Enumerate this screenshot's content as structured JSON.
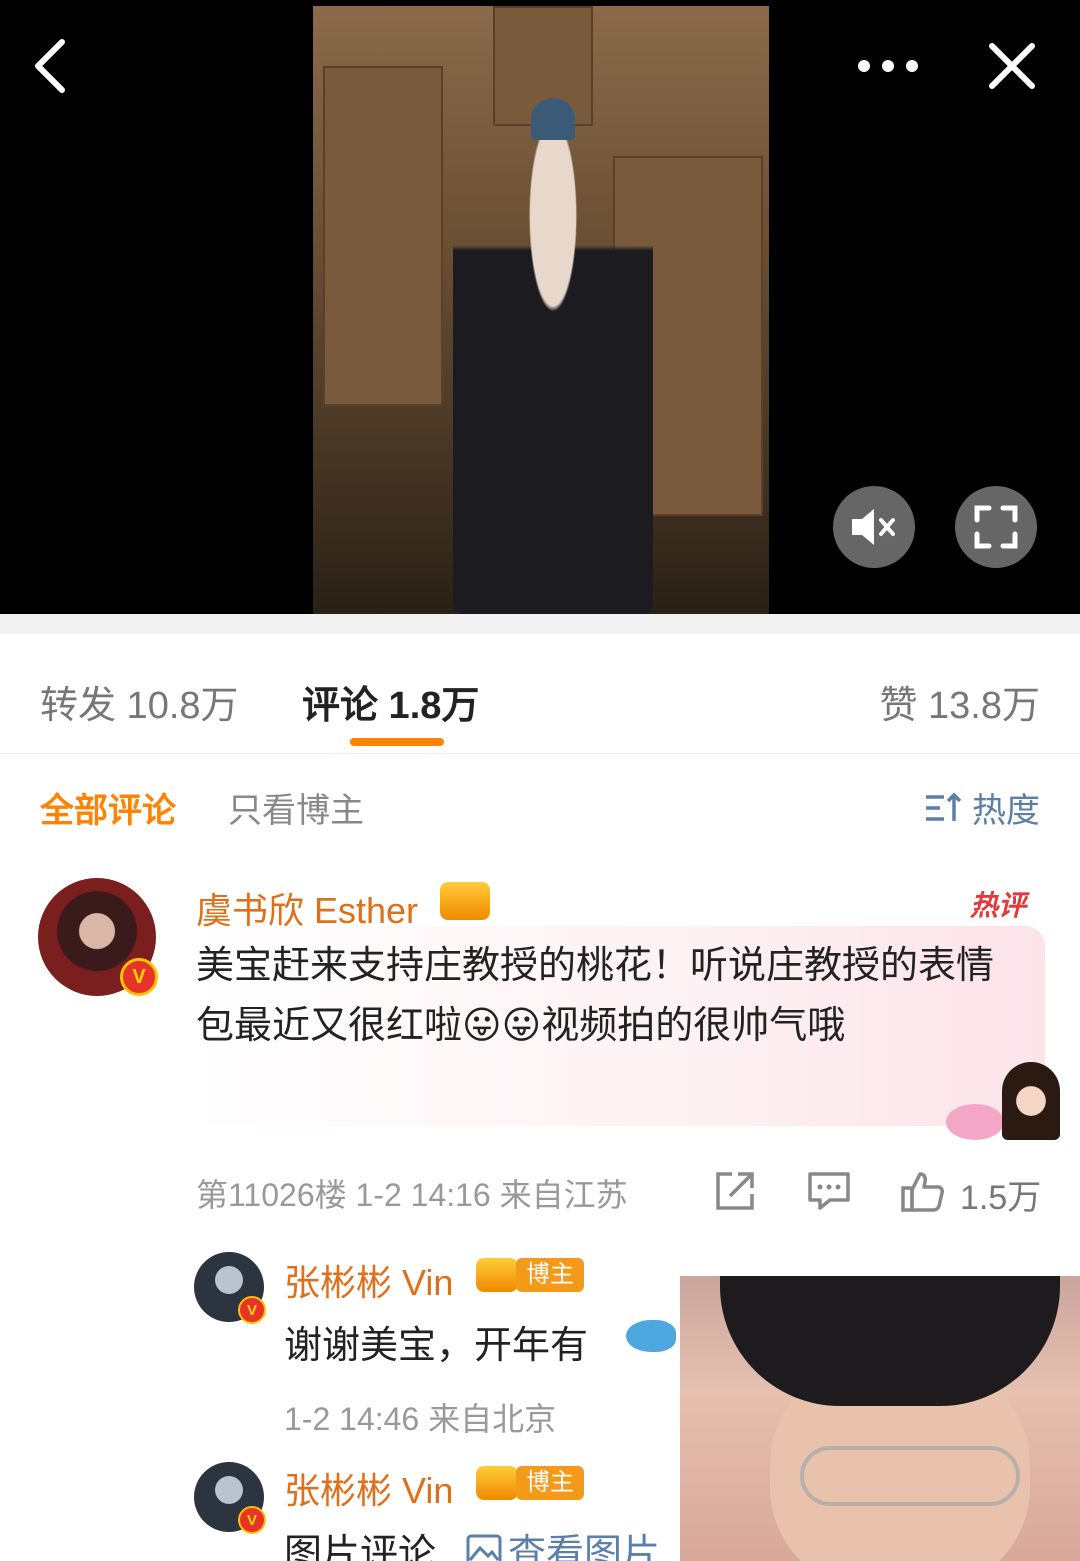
{
  "video": {
    "back_icon": "chevron-left-icon",
    "more_icon": "more-dots-icon",
    "close_icon": "close-icon",
    "mute_icon": "mute-icon",
    "fullscreen_icon": "fullscreen-icon"
  },
  "stats": {
    "repost": "转发 10.8万",
    "comment": "评论 1.8万",
    "like": "赞 13.8万"
  },
  "filter": {
    "all": "全部评论",
    "blogger_only": "只看博主",
    "sort": "热度"
  },
  "comment": {
    "username": "虞书欣 Esther",
    "hot_tag": "热评",
    "text": "美宝赶来支持庄教授的桃花！听说庄教授的表情包最近又很红啦😛😛视频拍的很帅气哦",
    "meta": "第11026楼 1-2 14:16 来自江苏",
    "like_count": "1.5万",
    "verified_badge": "V"
  },
  "replies": [
    {
      "username": "张彬彬 Vin",
      "badge": "博主",
      "text": "谢谢美宝，开年有",
      "meta": "1-2 14:46 来自北京"
    },
    {
      "username": "张彬彬 Vin",
      "badge": "博主",
      "text": "图片评论",
      "link": "查看图片"
    }
  ],
  "colors": {
    "accent": "#ff8200",
    "username": "#e06f1a",
    "link": "#5b7fa8"
  }
}
